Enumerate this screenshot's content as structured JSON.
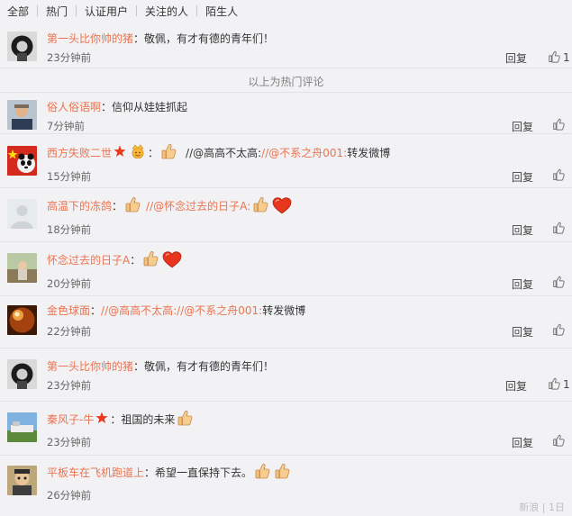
{
  "tabs": [
    "全部",
    "热门",
    "认证用户",
    "关注的人",
    "陌生人"
  ],
  "hot_divider": "以上为热门评论",
  "reply_label": "回复",
  "comments": [
    {
      "user": "第一头比你帅的猪",
      "text": "：敬佩，有才有德的青年们！",
      "time": "23分钟前",
      "likes": "1"
    },
    {
      "user": "俗人俗语啊",
      "text": "：信仰从娃娃抓起",
      "time": "7分钟前"
    },
    {
      "user": "西方失败二世",
      "sep": "：",
      "repost1": "//@高高不太高:",
      "repost2": "//@不系之舟001:",
      "text": " 转发微博",
      "time": "15分钟前"
    },
    {
      "user": "高温下的冻鸽",
      "sep": "：",
      "repost1": "//@怀念过去的日子A:",
      "time": "18分钟前"
    },
    {
      "user": "怀念过去的日子A",
      "sep": "：",
      "time": "20分钟前"
    },
    {
      "user": "金色球面",
      "sep": "：",
      "repost1": "//@高高不太高:",
      "repost2": "//@不系之舟001:",
      "text": " 转发微博",
      "time": "22分钟前"
    },
    {
      "user": "第一头比你帅的猪",
      "text": "：敬佩，有才有德的青年们！",
      "time": "23分钟前",
      "likes": "1"
    },
    {
      "user": "秦风子-牛",
      "text": "：祖国的未来",
      "time": "23分钟前"
    },
    {
      "user": "平板车在飞机跑道上",
      "text": "：希望一直保持下去。",
      "time": "26分钟前"
    }
  ],
  "watermark": "新浪 | 1日",
  "colors": {
    "accent": "#eb7350",
    "background": "#f2f2f5"
  }
}
